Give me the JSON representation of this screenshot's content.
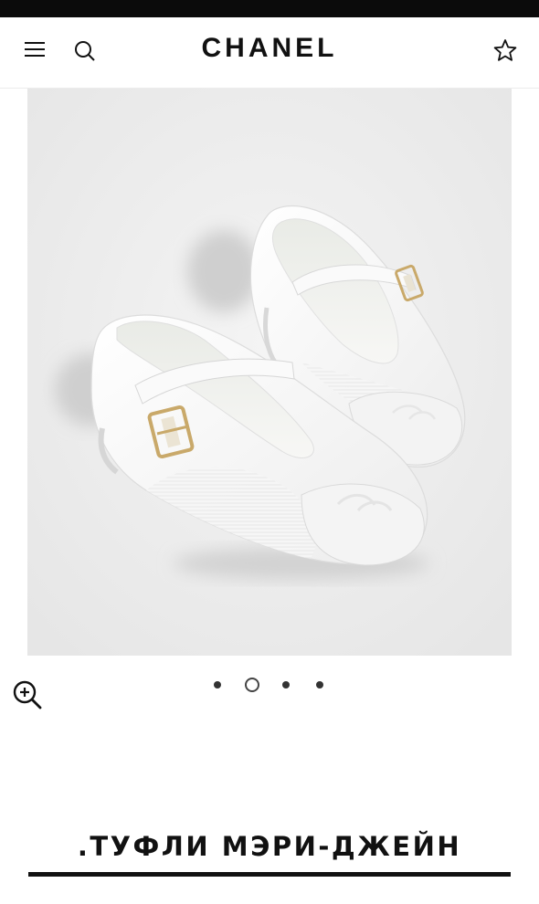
{
  "header": {
    "brand": "CHANEL",
    "menu_icon": "hamburger-menu-icon",
    "search_icon": "search-icon",
    "wishlist_icon": "star-icon"
  },
  "product": {
    "image_alt": "white Mary Jane shoes with gold buckle and cap toe",
    "zoom_icon": "zoom-in-icon",
    "title": ".ТУФЛИ МЭРИ-ДЖЕЙН"
  },
  "carousel": {
    "total": 4,
    "active_index": 1
  },
  "colors": {
    "top_bar": "#0b0b0b",
    "image_background": "#ebebeb",
    "text": "#111111"
  }
}
